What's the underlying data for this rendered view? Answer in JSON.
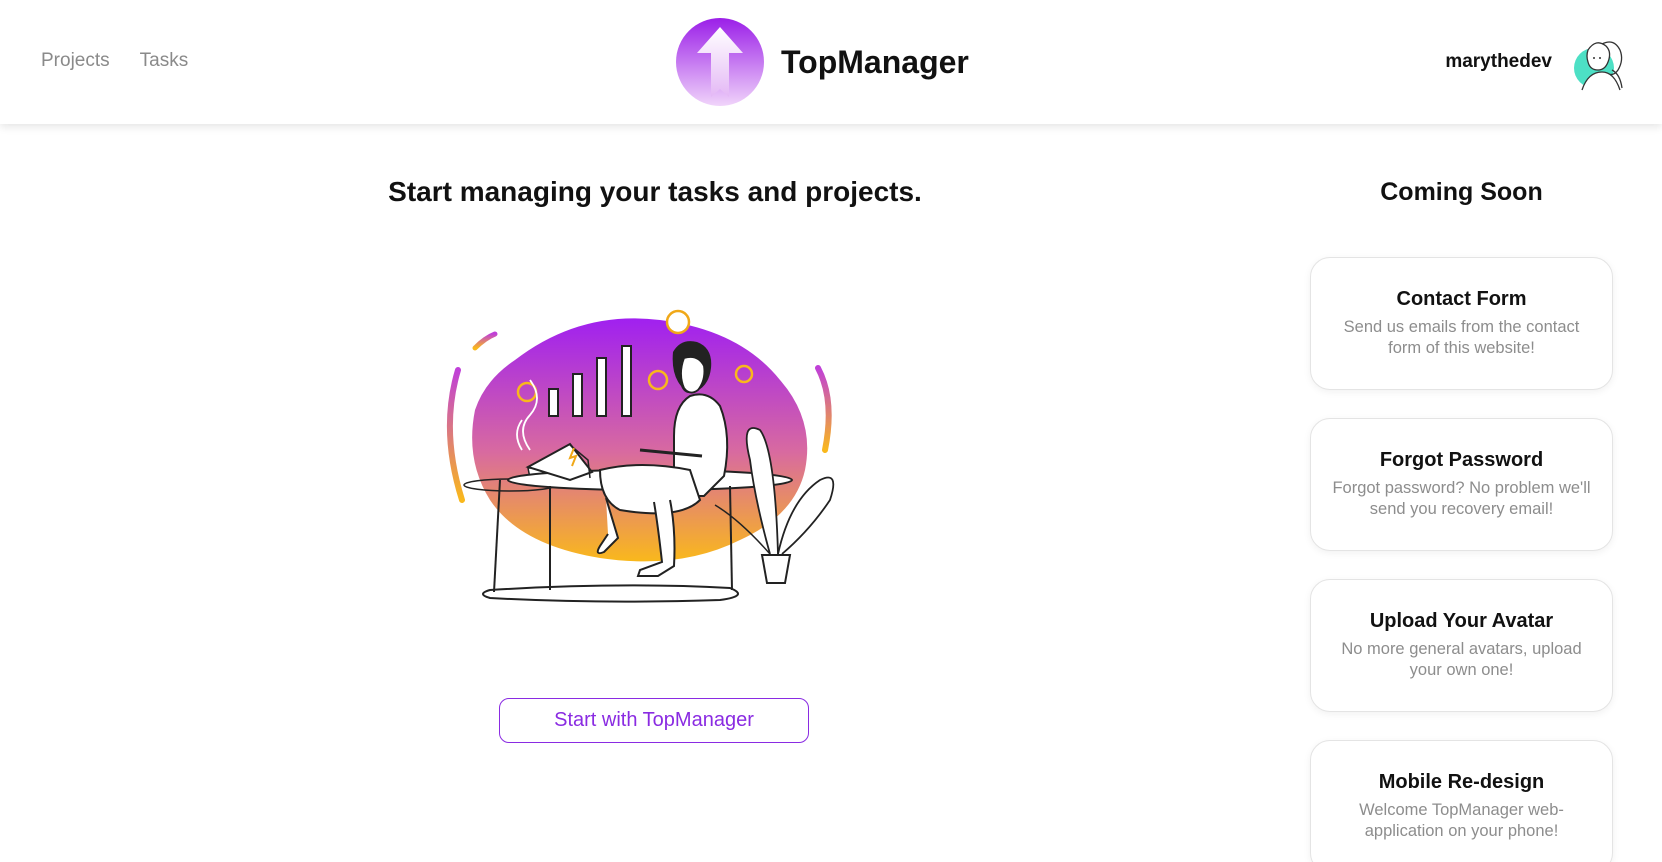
{
  "nav": {
    "projects": "Projects",
    "tasks": "Tasks"
  },
  "brand": {
    "name": "TopManager",
    "logo_icon": "arrow-up-logo-icon"
  },
  "user": {
    "username": "marythedev",
    "avatar_icon": "avatar-illustration"
  },
  "main": {
    "title": "Start managing your tasks and projects.",
    "illustration": "woman-working-at-desk-illustration",
    "cta_label": "Start with TopManager"
  },
  "sidebar": {
    "title": "Coming Soon",
    "cards": [
      {
        "title": "Contact Form",
        "desc": "Send us emails from the contact form of this website!"
      },
      {
        "title": "Forgot Password",
        "desc": "Forgot password? No problem we'll send you recovery email!"
      },
      {
        "title": "Upload Your Avatar",
        "desc": "No more general avatars, upload your own one!"
      },
      {
        "title": "Mobile Re-design",
        "desc": "Welcome TopManager web-application on your phone!"
      }
    ]
  },
  "colors": {
    "accent": "#8a2be2",
    "gradient_top": "#a020f0",
    "gradient_bottom": "#f9b81c",
    "muted_text": "#8d8d8d"
  }
}
